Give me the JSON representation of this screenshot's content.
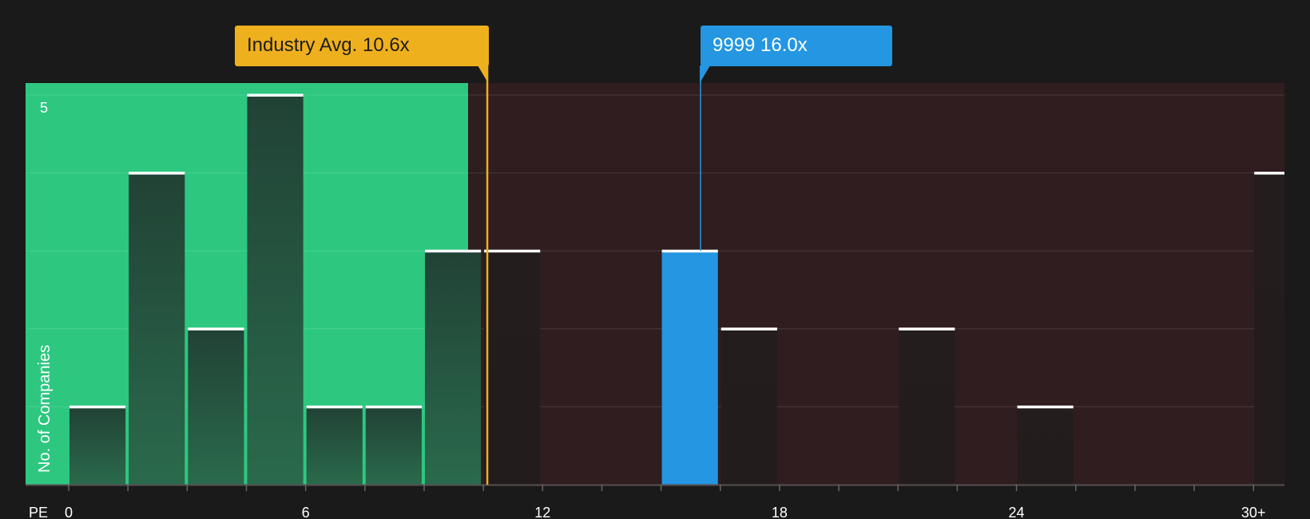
{
  "chart_data": {
    "type": "bar",
    "xlabel": "PE",
    "ylabel": "No. of Companies",
    "ylim": [
      0,
      5
    ],
    "y_ticks": [
      5
    ],
    "x_tick_labels": [
      {
        "value": 0,
        "label": "0"
      },
      {
        "value": 6,
        "label": "6"
      },
      {
        "value": 12,
        "label": "12"
      },
      {
        "value": 18,
        "label": "18"
      },
      {
        "value": 24,
        "label": "24"
      },
      {
        "value": 30,
        "label": "30+"
      }
    ],
    "bin_width": 1.5,
    "bins": [
      {
        "start": 0,
        "count": 1
      },
      {
        "start": 1.5,
        "count": 4
      },
      {
        "start": 3,
        "count": 2
      },
      {
        "start": 4.5,
        "count": 5
      },
      {
        "start": 6,
        "count": 1
      },
      {
        "start": 7.5,
        "count": 1
      },
      {
        "start": 9,
        "count": 3
      },
      {
        "start": 10.5,
        "count": 3
      },
      {
        "start": 12,
        "count": 0
      },
      {
        "start": 13.5,
        "count": 0
      },
      {
        "start": 15,
        "count": 3,
        "highlight": true
      },
      {
        "start": 16.5,
        "count": 2
      },
      {
        "start": 18,
        "count": 0
      },
      {
        "start": 19.5,
        "count": 0
      },
      {
        "start": 21,
        "count": 2
      },
      {
        "start": 22.5,
        "count": 0
      },
      {
        "start": 24,
        "count": 1
      },
      {
        "start": 25.5,
        "count": 0
      },
      {
        "start": 27,
        "count": 0
      },
      {
        "start": 28.5,
        "count": 0
      },
      {
        "start": 30,
        "count": 4
      }
    ],
    "industry_avg": {
      "value": 10.6,
      "label": "Industry Avg. 10.6x",
      "color": "#efb01e"
    },
    "company": {
      "value": 16.0,
      "label": "9999 16.0x",
      "color": "#2596e2"
    },
    "grid": true,
    "colors": {
      "undervalued_region": "#2ec780",
      "overvalued_region": "#2f1d1f",
      "bar_top_line": "#ffffff",
      "background": "#1a1a1a"
    }
  }
}
